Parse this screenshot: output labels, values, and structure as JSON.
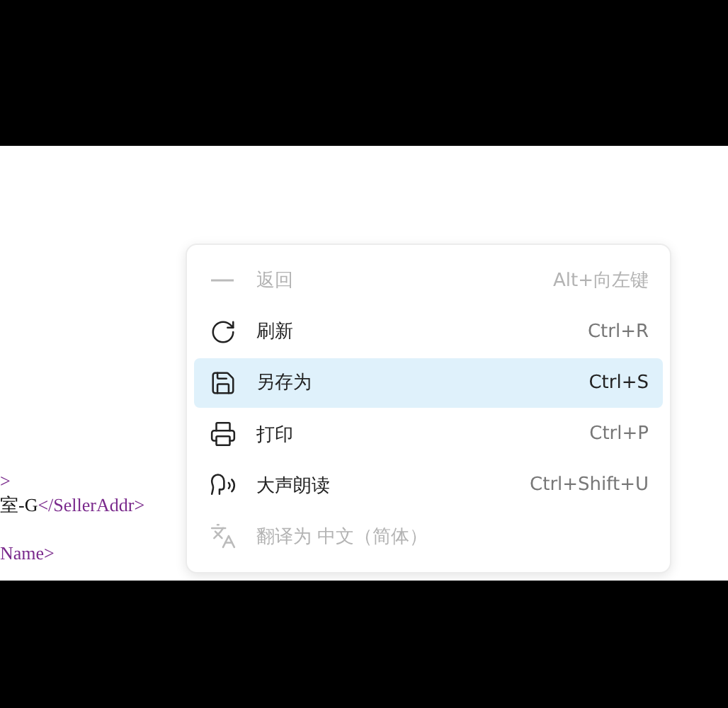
{
  "code_lines": [
    {
      "parts": [
        {
          "kind": "tag",
          "text": ">"
        }
      ]
    },
    {
      "parts": [
        {
          "kind": "text",
          "text": "室-G"
        },
        {
          "kind": "tag",
          "text": "</SellerAddr>"
        }
      ]
    },
    {
      "parts": [
        {
          "kind": "tag",
          "text": "Name>"
        }
      ]
    }
  ],
  "context_menu": {
    "items": [
      {
        "label": "返回",
        "shortcut": "Alt+向左键",
        "disabled": true,
        "selected": false
      },
      {
        "label": "刷新",
        "shortcut": "Ctrl+R",
        "disabled": false,
        "selected": false
      },
      {
        "label": "另存为",
        "shortcut": "Ctrl+S",
        "disabled": false,
        "selected": true
      },
      {
        "label": "打印",
        "shortcut": "Ctrl+P",
        "disabled": false,
        "selected": false
      },
      {
        "label": "大声朗读",
        "shortcut": "Ctrl+Shift+U",
        "disabled": false,
        "selected": false
      },
      {
        "label": "翻译为 中文（简体）",
        "disabled": true,
        "selected": false
      }
    ]
  }
}
